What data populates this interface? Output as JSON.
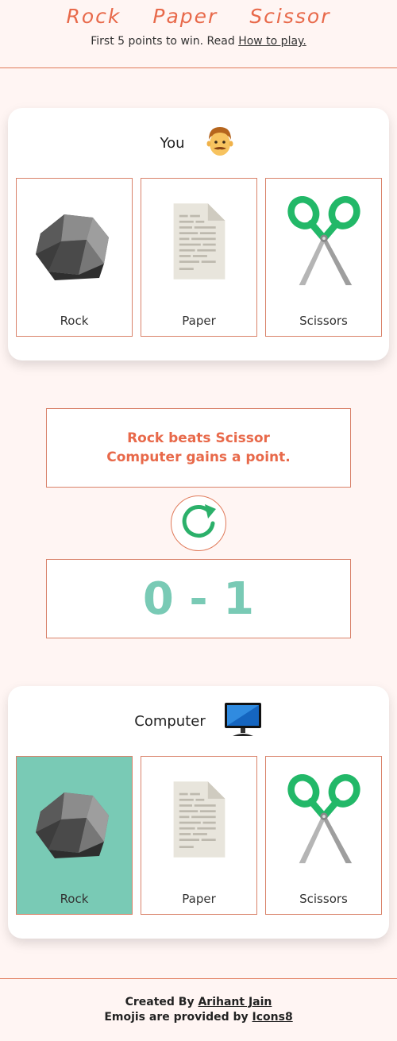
{
  "header": {
    "title_words": [
      "Rock",
      "Paper",
      "Scissor"
    ],
    "subtitle_prefix": "First 5 points to win. Read ",
    "how_to_link": "How to play."
  },
  "player": {
    "label": "You",
    "avatar_icon": "man-face-icon",
    "choices": [
      {
        "label": "Rock",
        "icon": "rock-icon"
      },
      {
        "label": "Paper",
        "icon": "paper-icon"
      },
      {
        "label": "Scissors",
        "icon": "scissors-icon"
      }
    ]
  },
  "result": {
    "line1": "Rock beats Scissor",
    "line2": "Computer gains a point."
  },
  "restart": {
    "icon": "restart-icon",
    "color": "#2bb06a"
  },
  "score": {
    "text": "0 - 1"
  },
  "computer": {
    "label": "Computer",
    "avatar_icon": "monitor-icon",
    "selected": "Rock",
    "choices": [
      {
        "label": "Rock",
        "icon": "rock-icon"
      },
      {
        "label": "Paper",
        "icon": "paper-icon"
      },
      {
        "label": "Scissors",
        "icon": "scissors-icon"
      }
    ]
  },
  "footer": {
    "created_prefix": "Created By ",
    "author": "Arihant Jain",
    "emoji_prefix": "Emojis are provided by ",
    "emoji_source": "Icons8"
  },
  "colors": {
    "accent": "#e8694a",
    "selected": "#79cab5",
    "background": "#fff5f3"
  }
}
